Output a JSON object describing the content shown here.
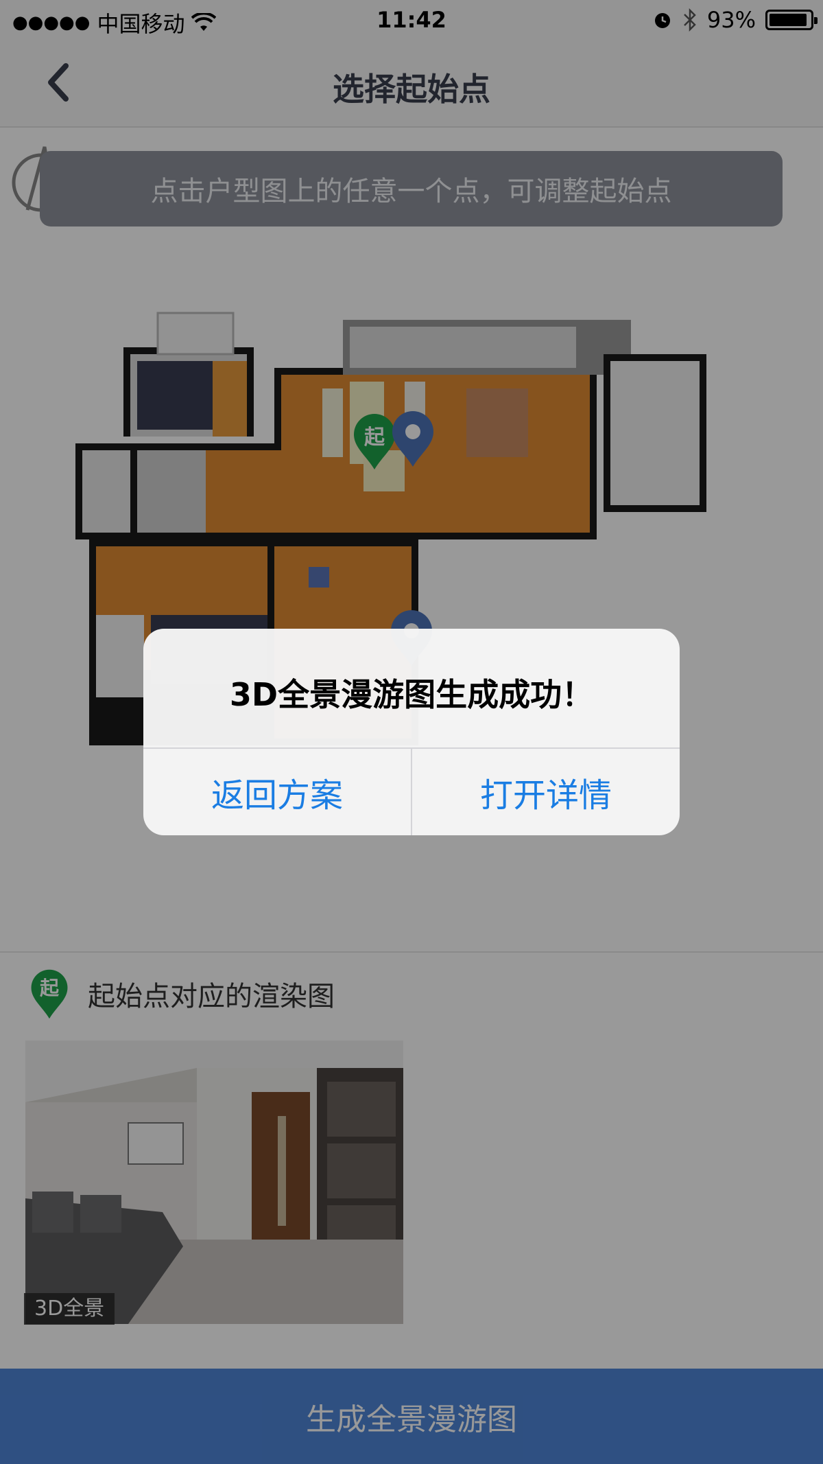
{
  "status_bar": {
    "signal": "●●●●●",
    "carrier": "中国移动",
    "time": "11:42",
    "battery_text": "93%",
    "battery_level": 0.93
  },
  "nav": {
    "title": "选择起始点",
    "back_icon": "chevron-left-icon"
  },
  "plan": {
    "hint": "点击户型图上的任意一个点，可调整起始点",
    "start_pin_label": "起"
  },
  "render": {
    "title": "起始点对应的渲染图",
    "pin_label": "起",
    "thumb_tag": "3D全景"
  },
  "footer": {
    "generate_label": "生成全景漫游图"
  },
  "alert": {
    "title": "3D全景漫游图生成成功！",
    "back_label": "返回方案",
    "open_label": "打开详情"
  },
  "colors": {
    "accent": "#1a7de3",
    "primary_button": "#4f86d8",
    "start_pin": "#1fa24a",
    "camera_pin": "#4d73b8"
  }
}
